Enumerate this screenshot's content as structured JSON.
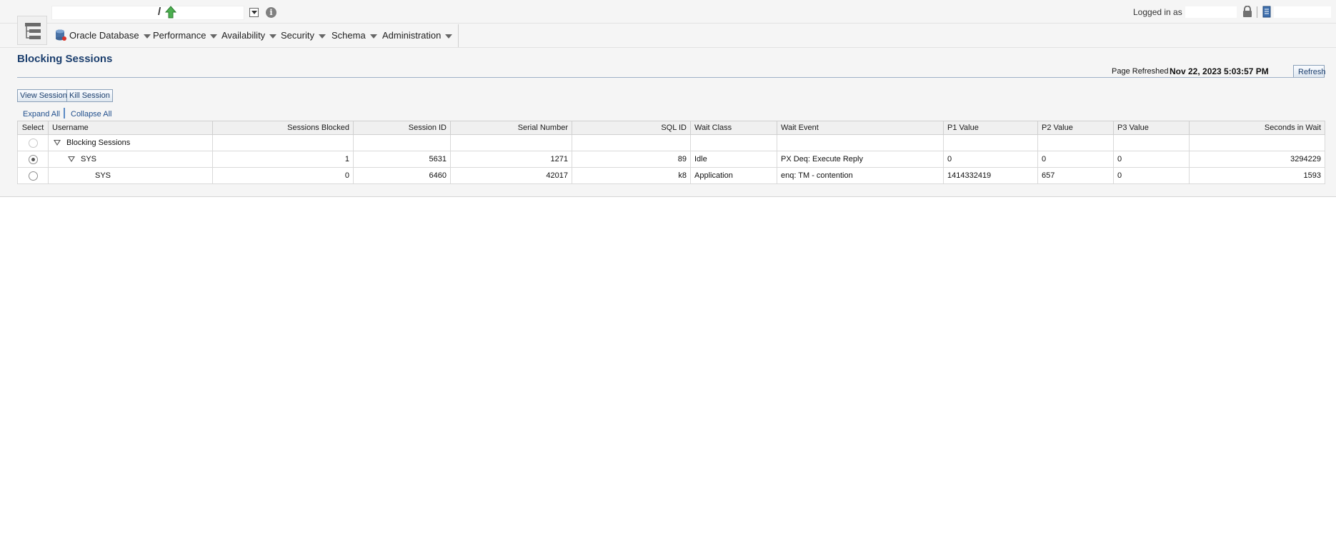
{
  "header": {
    "target_separator": "/",
    "login_label": "Logged in as"
  },
  "menu": [
    {
      "label": "Oracle Database"
    },
    {
      "label": "Performance"
    },
    {
      "label": "Availability"
    },
    {
      "label": "Security"
    },
    {
      "label": "Schema"
    },
    {
      "label": "Administration"
    }
  ],
  "page": {
    "title": "Blocking Sessions",
    "refreshed_label": "Page Refreshed",
    "refreshed_value": "Nov 22, 2023 5:03:57 PM",
    "refresh_button": "Refresh"
  },
  "toolbar": {
    "view_session": "View Session",
    "kill_session": "Kill Session",
    "expand_all": "Expand All",
    "collapse_all": "Collapse All"
  },
  "table": {
    "columns": [
      "Select",
      "Username",
      "Sessions Blocked",
      "Session ID",
      "Serial Number",
      "SQL ID",
      "Wait Class",
      "Wait Event",
      "P1 Value",
      "P2 Value",
      "P3 Value",
      "Seconds in Wait"
    ],
    "group_label": "Blocking Sessions",
    "rows": [
      {
        "username": "SYS",
        "sessions_blocked": "1",
        "session_id": "5631",
        "serial_number": "1271",
        "sql_id": "89",
        "wait_class": "Idle",
        "wait_event": "PX Deq: Execute Reply",
        "p1": "0",
        "p2": "0",
        "p3": "0",
        "seconds_in_wait": "3294229"
      },
      {
        "username": "SYS",
        "sessions_blocked": "0",
        "session_id": "6460",
        "serial_number": "42017",
        "sql_id": "k8",
        "wait_class": "Application",
        "wait_event": "enq: TM - contention",
        "p1": "1414332419",
        "p2": "657",
        "p3": "0",
        "seconds_in_wait": "1593"
      }
    ]
  },
  "colors": {
    "title": "#1c3f6e",
    "link": "#1f4e8c",
    "up_arrow": "#4caf50"
  },
  "icons": [
    "nav-tree-icon",
    "up-arrow-icon",
    "dropdown-icon",
    "info-icon",
    "lock-icon",
    "server-icon",
    "database-icon"
  ]
}
